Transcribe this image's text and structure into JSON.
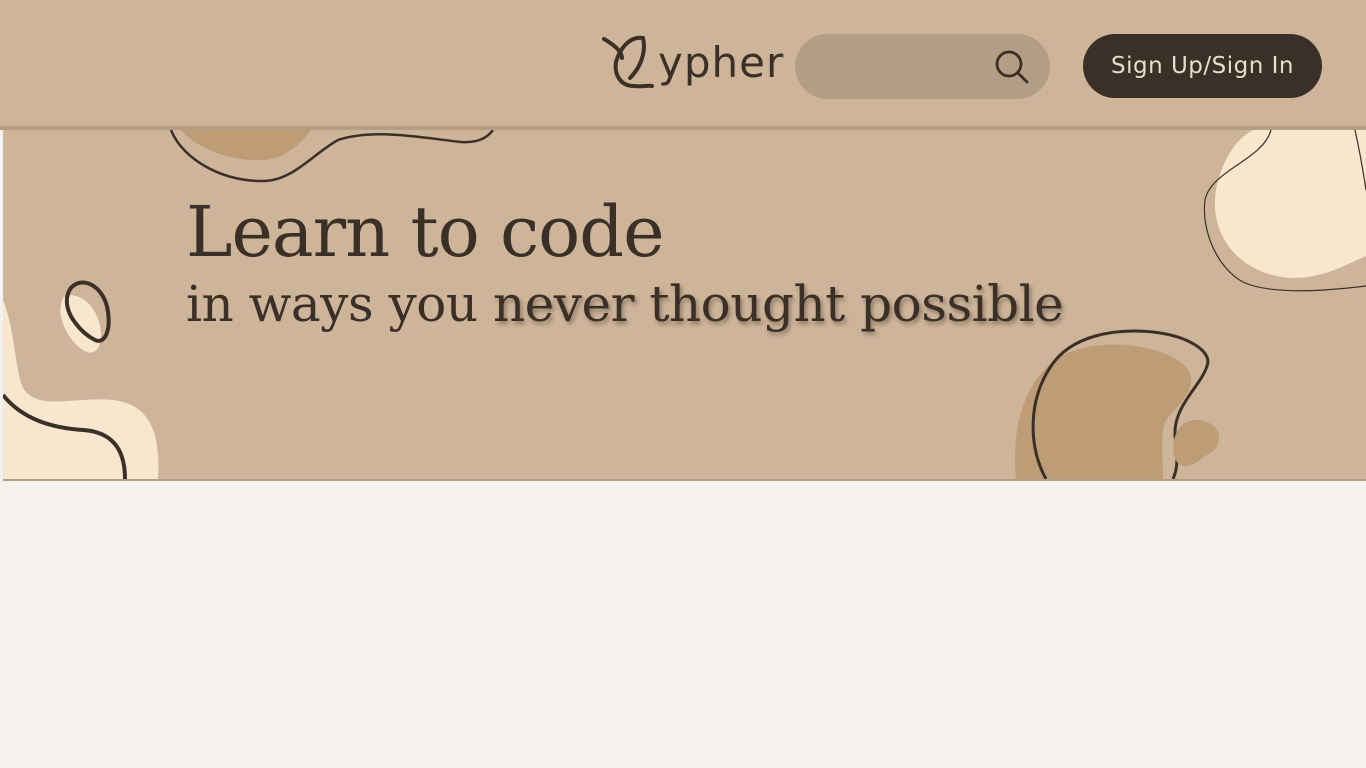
{
  "header": {
    "logo_text": "ypher",
    "search": {
      "value": "",
      "placeholder": ""
    },
    "auth_button_label": "Sign Up/Sign In"
  },
  "hero": {
    "title": "Learn to code",
    "subtitle_plain": "in ways you ",
    "subtitle_emphasis": "never thought possible"
  },
  "colors": {
    "header_bg": "#ceb59a",
    "page_bg": "#f5f2ed",
    "search_bg": "#b39d85",
    "dark_brown": "#3b3027",
    "accent_tan": "#bd9c76",
    "cream": "#f8e6cf"
  },
  "icons": {
    "logo": "leaf-c-logo-icon",
    "search": "search-icon"
  }
}
